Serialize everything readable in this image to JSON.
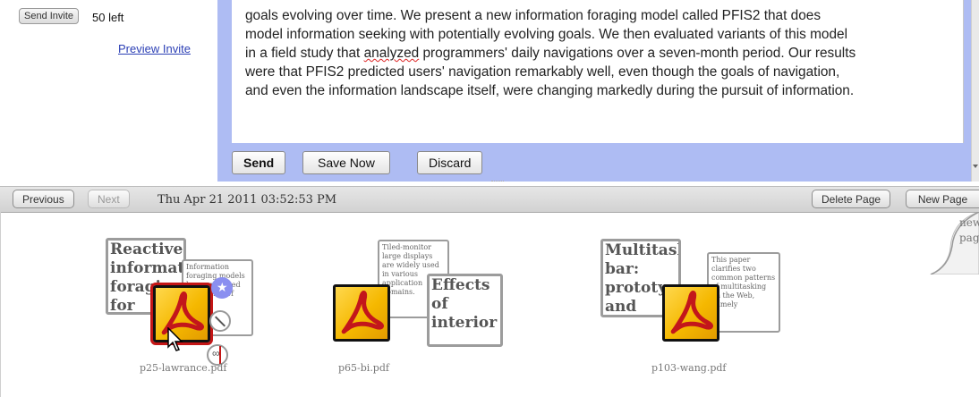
{
  "invite": {
    "send_label": "Send Invite",
    "left_text": "50 left",
    "preview_label": "Preview Invite"
  },
  "compose": {
    "lines_before": [
      "goals evolving over time. We present a new information foraging model called PFIS2 that does",
      "model information seeking with potentially evolving goals. We then evaluated variants of this model"
    ],
    "line3_a": "in a field study that ",
    "line3_misspelled": "analyzed",
    "line3_b": " programmers' daily navigations over a seven-month period. Our results",
    "lines_after": [
      "were that PFIS2 predicted users' navigation remarkably well, even though the goals of navigation,",
      "and even the information landscape itself, were changing markedly during the pursuit of information."
    ],
    "buttons": {
      "send": "Send",
      "save": "Save Now",
      "discard": "Discard"
    }
  },
  "pager": {
    "previous": "Previous",
    "next": "Next",
    "date": "Thu Apr 21 2011 03:52:53 PM",
    "delete_page": "Delete Page",
    "new_page": "New Page"
  },
  "curl_text": [
    "new",
    "page"
  ],
  "documents": [
    {
      "filename": "p25-lawrance.pdf",
      "big_title": "Reactive information foraging for",
      "small_text": "Information foraging models have predicted navigation of people"
    },
    {
      "filename": "p65-bi.pdf",
      "big_title": "Effects of interior",
      "small_text": "Tiled-monitor large displays are widely used in various application domains."
    },
    {
      "filename": "p103-wang.pdf",
      "big_title": "Multitask bar: prototype and",
      "small_text": "This paper clarifies two common patterns of multitasking on the Web, namely"
    }
  ],
  "colors": {
    "compose_frame": "#aebcf3",
    "selection": "#c41616",
    "pdf_yellow": "#f5b800",
    "pdf_red": "#c3161b",
    "star_purple": "#8a8ff0"
  }
}
